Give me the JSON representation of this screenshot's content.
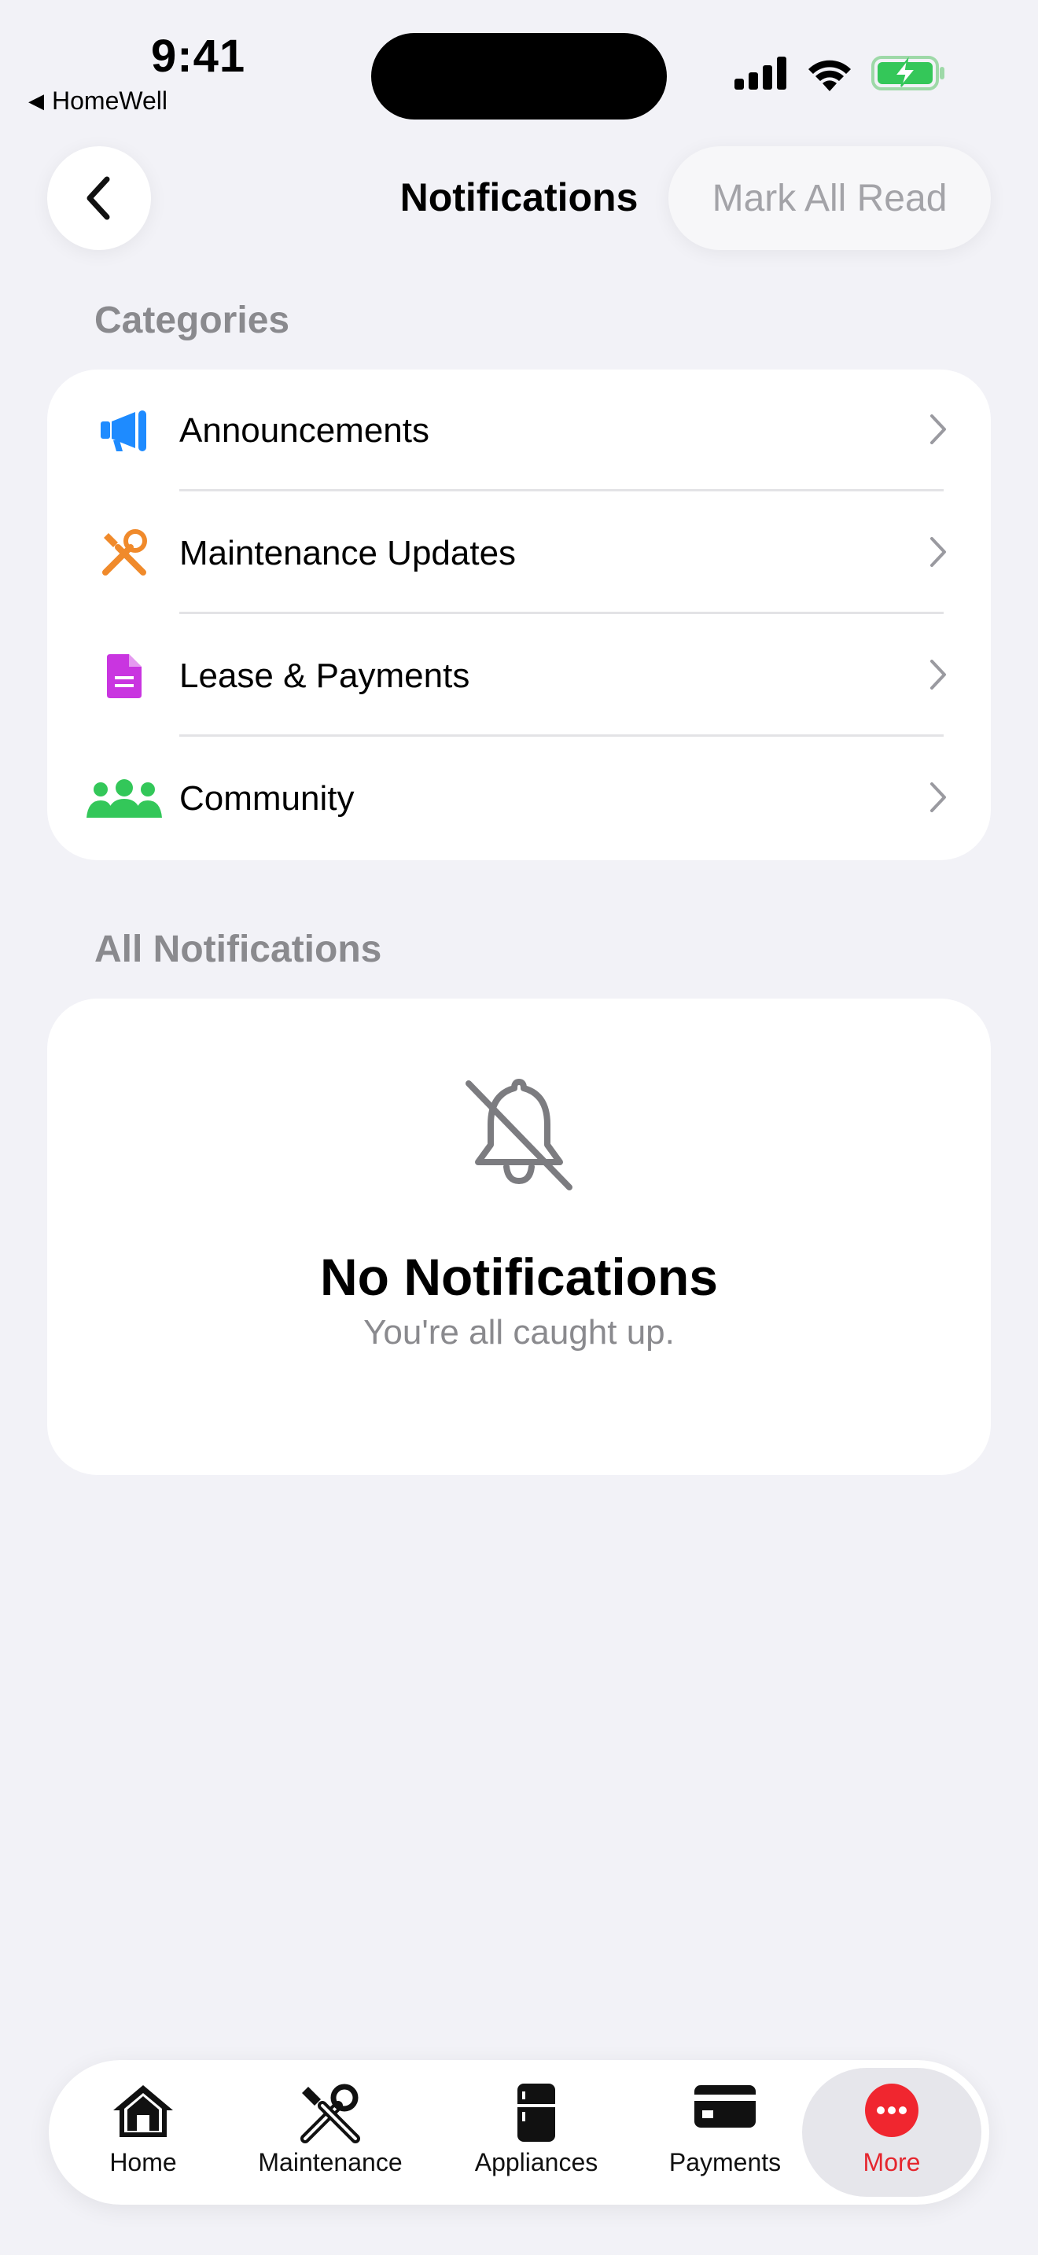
{
  "status_bar": {
    "time": "9:41",
    "back_app": "HomeWell"
  },
  "nav": {
    "title": "Notifications",
    "mark_all_read": "Mark All Read"
  },
  "sections": {
    "categories": "Categories",
    "all_notifications": "All Notifications"
  },
  "categories": [
    {
      "label": "Announcements",
      "icon": "megaphone-icon",
      "color": "#1E8BFF"
    },
    {
      "label": "Maintenance Updates",
      "icon": "tools-icon",
      "color": "#F08A2B"
    },
    {
      "label": "Lease & Payments",
      "icon": "document-icon",
      "color": "#C935E0"
    },
    {
      "label": "Community",
      "icon": "people-icon",
      "color": "#33C759"
    }
  ],
  "empty_state": {
    "title": "No Notifications",
    "subtitle": "You're all caught up."
  },
  "tabs": [
    {
      "label": "Home",
      "icon": "home-icon"
    },
    {
      "label": "Maintenance",
      "icon": "tools-icon"
    },
    {
      "label": "Appliances",
      "icon": "fridge-icon"
    },
    {
      "label": "Payments",
      "icon": "credit-card-icon"
    },
    {
      "label": "More",
      "icon": "more-icon",
      "active": true,
      "accent": "#F0262F"
    }
  ]
}
